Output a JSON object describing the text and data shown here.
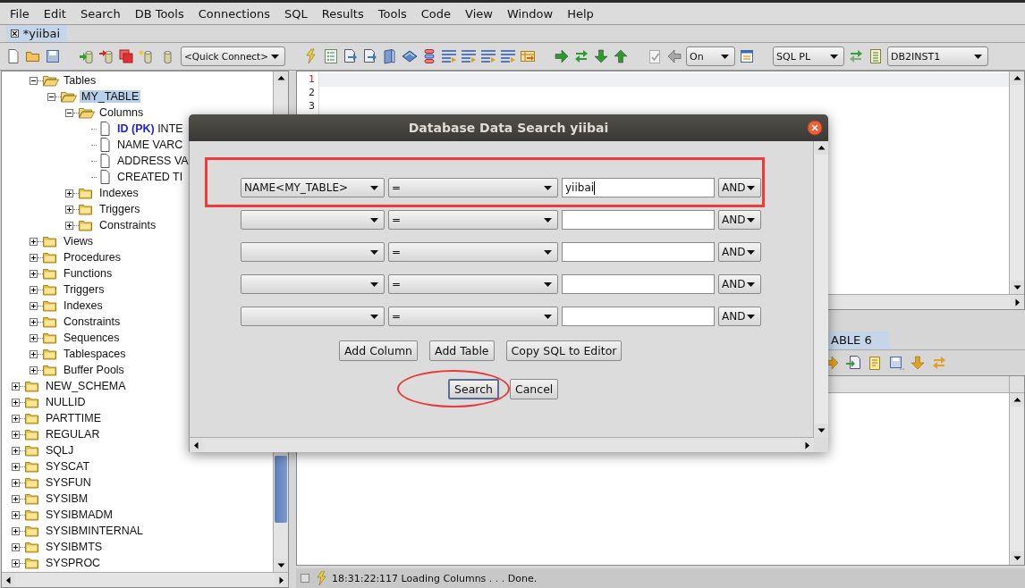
{
  "menu": [
    "File",
    "Edit",
    "Search",
    "DB Tools",
    "Connections",
    "SQL",
    "Results",
    "Tools",
    "Code",
    "View",
    "Window",
    "Help"
  ],
  "document_tab": {
    "label": "*yiibai",
    "selected": true
  },
  "toolbar": {
    "quick_connect": "<Quick Connect>",
    "auto_commit": "On",
    "language": "SQL PL",
    "database": "DB2INST1"
  },
  "tree": {
    "schema_children": [
      {
        "label": "Tables",
        "kind": "folder",
        "expanded": true,
        "selected": false,
        "children": [
          {
            "label": "MY_TABLE",
            "kind": "folder",
            "expanded": true,
            "selected": true,
            "children": [
              {
                "label": "Columns",
                "kind": "folder",
                "expanded": true,
                "selected": false,
                "children": [
                  {
                    "label": "**ID (PK)** INTE",
                    "kind": "column",
                    "selected": false
                  },
                  {
                    "label": "NAME VARC",
                    "kind": "column",
                    "selected": false
                  },
                  {
                    "label": "ADDRESS VA",
                    "kind": "column",
                    "selected": false
                  },
                  {
                    "label": "CREATED TI",
                    "kind": "column",
                    "selected": false
                  }
                ]
              },
              {
                "label": "Indexes",
                "kind": "folder",
                "expanded": false,
                "selected": false
              },
              {
                "label": "Triggers",
                "kind": "folder",
                "expanded": false,
                "selected": false
              },
              {
                "label": "Constraints",
                "kind": "folder",
                "expanded": false,
                "selected": false
              }
            ]
          }
        ]
      },
      {
        "label": "Views",
        "kind": "folder",
        "expanded": false,
        "selected": false
      },
      {
        "label": "Procedures",
        "kind": "folder",
        "expanded": false,
        "selected": false
      },
      {
        "label": "Functions",
        "kind": "folder",
        "expanded": false,
        "selected": false
      },
      {
        "label": "Triggers",
        "kind": "folder",
        "expanded": false,
        "selected": false
      },
      {
        "label": "Indexes",
        "kind": "folder",
        "expanded": false,
        "selected": false
      },
      {
        "label": "Constraints",
        "kind": "folder",
        "expanded": false,
        "selected": false
      },
      {
        "label": "Sequences",
        "kind": "folder",
        "expanded": false,
        "selected": false
      },
      {
        "label": "Tablespaces",
        "kind": "folder",
        "expanded": false,
        "selected": false
      },
      {
        "label": "Buffer Pools",
        "kind": "folder",
        "expanded": false,
        "selected": false
      }
    ],
    "schemas": [
      {
        "label": "NEW_SCHEMA",
        "kind": "folder",
        "expanded": false,
        "selected": false
      },
      {
        "label": "NULLID",
        "kind": "folder",
        "expanded": false,
        "selected": false
      },
      {
        "label": "PARTTIME",
        "kind": "folder",
        "expanded": false,
        "selected": false
      },
      {
        "label": "REGULAR",
        "kind": "folder",
        "expanded": false,
        "selected": false
      },
      {
        "label": "SQLJ",
        "kind": "folder",
        "expanded": false,
        "selected": false
      },
      {
        "label": "SYSCAT",
        "kind": "folder",
        "expanded": false,
        "selected": false
      },
      {
        "label": "SYSFUN",
        "kind": "folder",
        "expanded": false,
        "selected": false
      },
      {
        "label": "SYSIBM",
        "kind": "folder",
        "expanded": false,
        "selected": false
      },
      {
        "label": "SYSIBMADM",
        "kind": "folder",
        "expanded": false,
        "selected": false
      },
      {
        "label": "SYSIBMINTERNAL",
        "kind": "folder",
        "expanded": false,
        "selected": false
      },
      {
        "label": "SYSIBMTS",
        "kind": "folder",
        "expanded": false,
        "selected": false
      },
      {
        "label": "SYSPROC",
        "kind": "folder",
        "expanded": false,
        "selected": false
      }
    ]
  },
  "editor": {
    "lines": [
      {
        "number": "1",
        "current": true
      },
      {
        "number": "2",
        "current": false
      },
      {
        "number": "3",
        "current": false
      }
    ]
  },
  "results": {
    "tab": {
      "label": "ABLE 6",
      "selected": true
    }
  },
  "status_bar": {
    "message": "18:31:22:117 Loading Columns . . . Done."
  },
  "dialog": {
    "title": "Database Data Search yiibai",
    "rows": [
      {
        "column": "NAME<MY_TABLE>",
        "operator": "=",
        "value": "yiibai",
        "conjunction": "AND",
        "highlighted": true
      },
      {
        "operator": "=",
        "conjunction": "AND",
        "highlighted": false
      },
      {
        "operator": "=",
        "conjunction": "AND",
        "highlighted": false
      },
      {
        "operator": "=",
        "conjunction": "AND",
        "highlighted": false
      },
      {
        "operator": "=",
        "conjunction": "AND",
        "highlighted": false
      }
    ],
    "tool_buttons": [
      {
        "label": "Add Column"
      },
      {
        "label": "Add Table"
      },
      {
        "label": "Copy SQL to Editor"
      }
    ],
    "confirm_buttons": [
      {
        "label": "Search",
        "default": true,
        "circled": true
      },
      {
        "label": "Cancel",
        "default": false,
        "circled": false
      }
    ]
  }
}
